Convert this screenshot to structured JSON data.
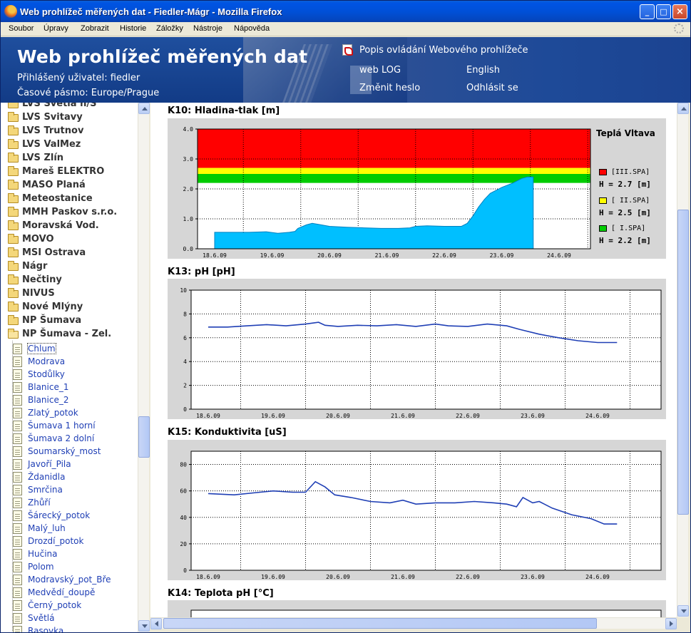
{
  "window": {
    "title": "Web prohlížeč měřených dat - Fiedler-Mágr - Mozilla Firefox"
  },
  "menu": [
    "Soubor",
    "Úpravy",
    "Zobrazit",
    "Historie",
    "Záložky",
    "Nástroje",
    "Nápověda"
  ],
  "header": {
    "site_title": "Web prohlížeč měřených dat",
    "user": "Přihlášený uživatel: fiedler",
    "timezone": "Časové pásmo: Europe/Prague",
    "manual_link": "Popis ovládání Webového prohlížeče",
    "weblog_link": "web LOG",
    "english_link": "English",
    "change_password_link": "Změnit heslo",
    "logout_link": "Odhlásit se"
  },
  "tree": {
    "folders": [
      "LVS Světlá n/S",
      "LVS Svitavy",
      "LVS Trutnov",
      "LVS ValMez",
      "LVS Zlín",
      "Mareš ELEKTRO",
      "MASO Planá",
      "Meteostanice",
      "MMH Paskov s.r.o.",
      "Moravská Vod.",
      "MOVO",
      "MSI Ostrava",
      "Nágr",
      "Nečtiny",
      "NIVUS",
      "Nové Mlýny",
      "NP Šumava",
      "NP Šumava - Zel."
    ],
    "stations": [
      "Chlum",
      "Modrava",
      "Stodůlky",
      "Blanice_1",
      "Blanice_2",
      "Zlatý_potok",
      "Šumava 1 horní",
      "Šumava 2 dolní",
      "Soumarský_most",
      "Javoří_Pila",
      "Ždanidla",
      "Smrčina",
      "Zhůří",
      "Šárecký_potok",
      "Malý_luh",
      "Drozdí_potok",
      "Hučina",
      "Polom",
      "Modravský_pot_Bře",
      "Medvědí_doupě",
      "Černý_potok",
      "Světlá",
      "Rasovka"
    ]
  },
  "charts": {
    "k10_title": "K10: Hladina-tlak [m]",
    "k13_title": "K13: pH [pH]",
    "k15_title": "K15: Konduktivita [uS]",
    "k14_title": "K14: Teplota pH [°C]",
    "k10_legend": {
      "title": "Teplá Vltava",
      "items": [
        {
          "label": "[III.SPA]",
          "value": "H = 2.7 [m]",
          "color": "#FF0000"
        },
        {
          "label": "[ II.SPA]",
          "value": "H = 2.5 [m]",
          "color": "#FFFF00"
        },
        {
          "label": "[  I.SPA]",
          "value": "H = 2.2 [m]",
          "color": "#00CC00"
        }
      ]
    }
  },
  "chart_data": [
    {
      "type": "area",
      "title": "K10: Hladina-tlak [m]",
      "x": [
        "18.6.09",
        "19.6.09",
        "20.6.09",
        "21.6.09",
        "22.6.09",
        "23.6.09",
        "24.6.09"
      ],
      "ylim": [
        0,
        4
      ],
      "yticks": [
        "0.0",
        "1.0",
        "2.0",
        "3.0",
        "4.0"
      ],
      "bands": [
        {
          "name": "[III.SPA]",
          "from": 2.7,
          "to": 4.0,
          "color": "#FF0000"
        },
        {
          "name": "[ II.SPA]",
          "from": 2.5,
          "to": 2.7,
          "color": "#FFFF00"
        },
        {
          "name": "[  I.SPA]",
          "from": 2.2,
          "to": 2.5,
          "color": "#00CC00"
        }
      ],
      "series": [
        {
          "color": "#00BFFF",
          "points": [
            [
              0.0,
              0.55
            ],
            [
              0.3,
              0.55
            ],
            [
              0.6,
              0.55
            ],
            [
              0.9,
              0.57
            ],
            [
              1.1,
              0.52
            ],
            [
              1.3,
              0.55
            ],
            [
              1.4,
              0.58
            ],
            [
              1.45,
              0.68
            ],
            [
              1.6,
              0.8
            ],
            [
              1.7,
              0.85
            ],
            [
              1.8,
              0.82
            ],
            [
              2.0,
              0.75
            ],
            [
              2.3,
              0.72
            ],
            [
              2.6,
              0.7
            ],
            [
              2.9,
              0.68
            ],
            [
              3.2,
              0.68
            ],
            [
              3.4,
              0.7
            ],
            [
              3.5,
              0.75
            ],
            [
              3.7,
              0.77
            ],
            [
              4.0,
              0.75
            ],
            [
              4.3,
              0.75
            ],
            [
              4.4,
              0.85
            ],
            [
              4.5,
              1.1
            ],
            [
              4.6,
              1.4
            ],
            [
              4.7,
              1.65
            ],
            [
              4.8,
              1.85
            ],
            [
              5.0,
              2.05
            ],
            [
              5.2,
              2.2
            ],
            [
              5.35,
              2.35
            ],
            [
              5.45,
              2.4
            ],
            [
              5.55,
              2.4
            ]
          ]
        }
      ],
      "grid": true
    },
    {
      "type": "line",
      "title": "K13: pH [pH]",
      "x": [
        "18.6.09",
        "19.6.09",
        "20.6.09",
        "21.6.09",
        "22.6.09",
        "23.6.09",
        "24.6.09"
      ],
      "ylim": [
        0,
        10
      ],
      "yticks": [
        "0",
        "2",
        "4",
        "6",
        "8",
        "10"
      ],
      "series": [
        {
          "color": "#1F3FB5",
          "points": [
            [
              0.0,
              6.9
            ],
            [
              0.3,
              6.9
            ],
            [
              0.6,
              7.0
            ],
            [
              0.9,
              7.1
            ],
            [
              1.2,
              7.0
            ],
            [
              1.5,
              7.15
            ],
            [
              1.7,
              7.3
            ],
            [
              1.8,
              7.05
            ],
            [
              2.0,
              6.95
            ],
            [
              2.3,
              7.05
            ],
            [
              2.6,
              7.0
            ],
            [
              2.9,
              7.1
            ],
            [
              3.2,
              6.95
            ],
            [
              3.5,
              7.15
            ],
            [
              3.7,
              7.0
            ],
            [
              4.0,
              6.95
            ],
            [
              4.3,
              7.15
            ],
            [
              4.6,
              7.0
            ],
            [
              4.8,
              6.7
            ],
            [
              5.1,
              6.3
            ],
            [
              5.4,
              6.0
            ],
            [
              5.7,
              5.75
            ],
            [
              6.0,
              5.6
            ],
            [
              6.3,
              5.6
            ]
          ]
        }
      ],
      "grid": true
    },
    {
      "type": "line",
      "title": "K15: Konduktivita [uS]",
      "x": [
        "18.6.09",
        "19.6.09",
        "20.6.09",
        "21.6.09",
        "22.6.09",
        "23.6.09",
        "24.6.09"
      ],
      "ylim": [
        0,
        90
      ],
      "yticks": [
        "0",
        "20",
        "40",
        "60",
        "80"
      ],
      "series": [
        {
          "color": "#1F3FB5",
          "points": [
            [
              0.0,
              58
            ],
            [
              0.4,
              57
            ],
            [
              0.8,
              59
            ],
            [
              1.0,
              60
            ],
            [
              1.3,
              59
            ],
            [
              1.5,
              59
            ],
            [
              1.65,
              67
            ],
            [
              1.8,
              63
            ],
            [
              1.95,
              57
            ],
            [
              2.2,
              55
            ],
            [
              2.5,
              52
            ],
            [
              2.8,
              51
            ],
            [
              3.0,
              53
            ],
            [
              3.2,
              50
            ],
            [
              3.5,
              51
            ],
            [
              3.8,
              51
            ],
            [
              4.1,
              52
            ],
            [
              4.4,
              51
            ],
            [
              4.6,
              50
            ],
            [
              4.75,
              48
            ],
            [
              4.85,
              55
            ],
            [
              5.0,
              51
            ],
            [
              5.1,
              52
            ],
            [
              5.3,
              47
            ],
            [
              5.6,
              42
            ],
            [
              5.9,
              39
            ],
            [
              6.1,
              35
            ],
            [
              6.3,
              35
            ]
          ]
        }
      ],
      "grid": true
    }
  ]
}
